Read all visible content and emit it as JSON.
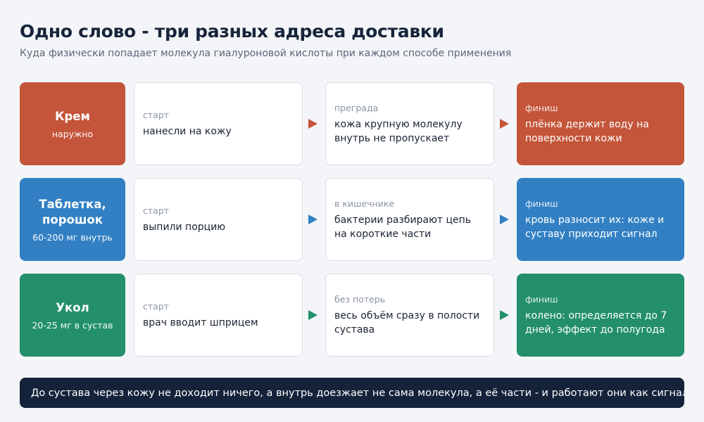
{
  "header": {
    "title": "Одно слово - три разных адреса доставки",
    "subtitle": "Куда физически попадает молекула гиалуроновой кислоты при каждом способе применения"
  },
  "rows": [
    {
      "color": "#c4553a",
      "label": "Крем",
      "note": "наружно",
      "steps": [
        {
          "caption": "старт",
          "text": "нанесли на кожу"
        },
        {
          "caption": "преграда",
          "text": "кожа крупную молекулу внутрь не пропускает"
        },
        {
          "caption": "финиш",
          "text": "плёнка держит воду на поверхности кожи"
        }
      ]
    },
    {
      "color": "#3280c3",
      "label": "Таблетка, порошок",
      "note": "60-200 мг внутрь",
      "steps": [
        {
          "caption": "старт",
          "text": "выпили порцию"
        },
        {
          "caption": "в кишечнике",
          "text": "бактерии разбирают цепь на короткие части"
        },
        {
          "caption": "финиш",
          "text": "кровь разносит их: коже и суставу приходит сигнал"
        }
      ]
    },
    {
      "color": "#23906b",
      "label": "Укол",
      "note": "20-25 мг в сустав",
      "steps": [
        {
          "caption": "старт",
          "text": "врач вводит шприцем"
        },
        {
          "caption": "без потерь",
          "text": "весь объём сразу в полости сустава"
        },
        {
          "caption": "финиш",
          "text": "колено: определяется до 7 дней, эффект до полугода"
        }
      ]
    }
  ],
  "footer": {
    "text": "До сустава через кожу не доходит ничего, а внутрь доезжает не сама молекула, а её части - и работают они как сигнал"
  }
}
